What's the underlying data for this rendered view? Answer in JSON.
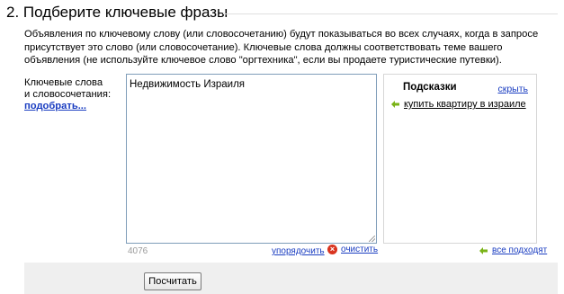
{
  "section": {
    "title": "2. Подберите ключевые фразы",
    "description": "Объявления по ключевому слову (или словосочетанию) будут показываться во всех случаях, когда в запросе присутствует это слово (или словосочетание). Ключевые слова должны соответствовать теме вашего объявления (не используйте ключевое слово \"оргтехника\", если вы продаете туристические путевки)."
  },
  "keywords": {
    "label_line1": "Ключевые слова",
    "label_line2": "и словосочетания:",
    "pick_link": "подобрать...",
    "value": "Недвижимость Израиля",
    "char_count": "4076",
    "sort_link": "упорядочить",
    "clear_link": "очистить"
  },
  "hints": {
    "title": "Подсказки",
    "hide_link": "скрыть",
    "items": [
      {
        "label": "купить квартиру в израиле"
      }
    ],
    "all_fit_link": "все подходят"
  },
  "actions": {
    "calculate_label": "Посчитать"
  },
  "colors": {
    "link": "#1a3dc1",
    "arrow": "#7ab317",
    "clear_icon": "#d9341f",
    "footer_bg": "#efefef"
  },
  "icons": {
    "arrow": "left-arrow-icon",
    "clear": "clear-x-icon"
  }
}
